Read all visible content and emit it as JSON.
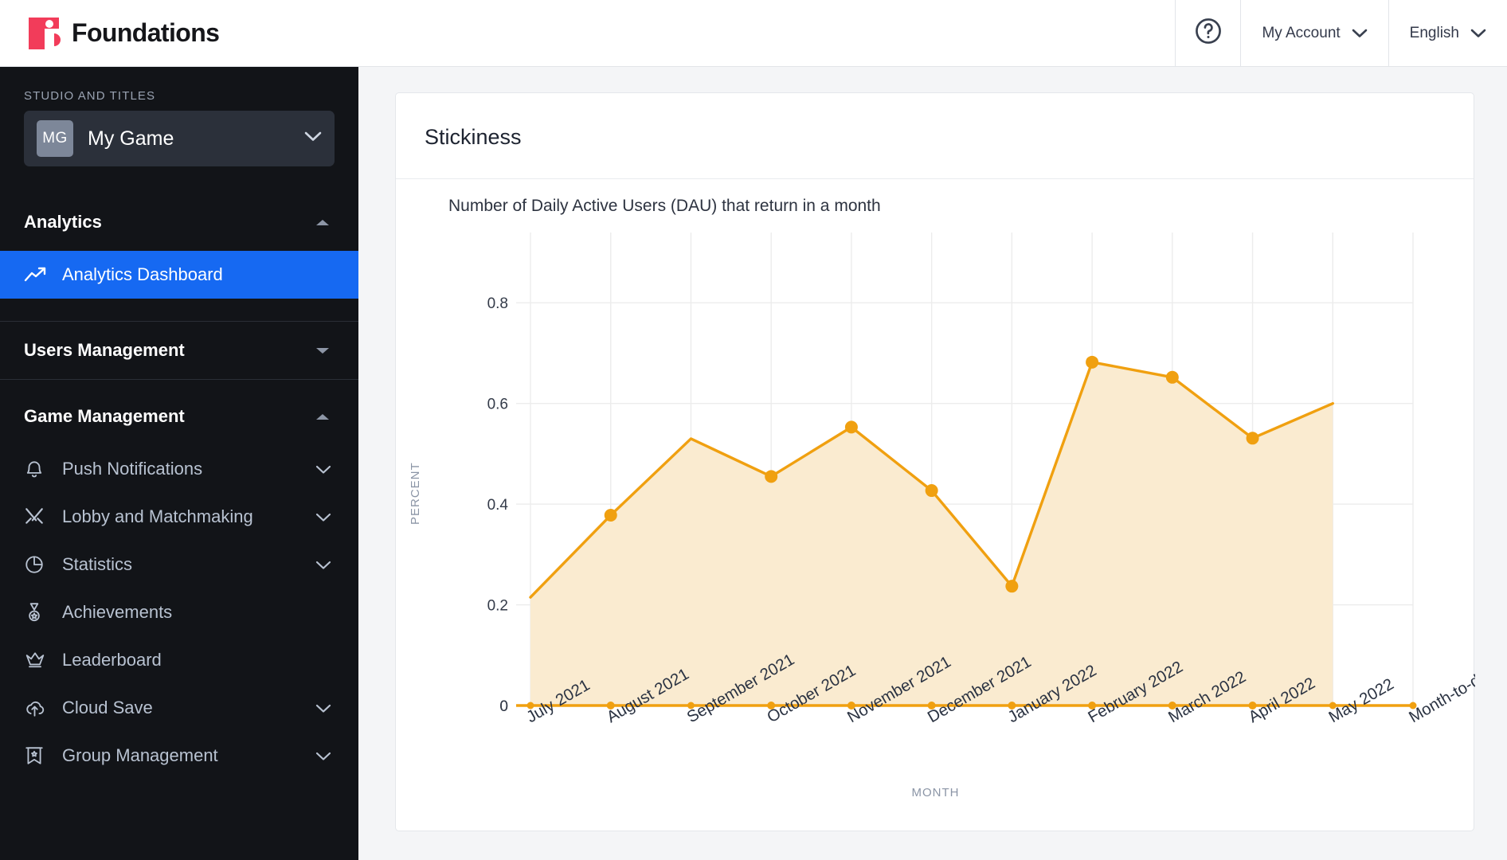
{
  "header": {
    "brand": "Foundations",
    "brand_color": "#F23C5A",
    "help_icon": "help-circle-icon",
    "account_label": "My Account",
    "language_label": "English"
  },
  "sidebar": {
    "studio_label": "STUDIO AND TITLES",
    "game": {
      "initials": "MG",
      "name": "My Game"
    },
    "sections": [
      {
        "id": "analytics",
        "label": "Analytics",
        "expanded": true,
        "items": [
          {
            "label": "Analytics Dashboard",
            "icon": "trending-up-icon",
            "active": true,
            "has_chevron": false
          }
        ]
      },
      {
        "id": "users-management",
        "label": "Users Management",
        "expanded": false,
        "items": []
      },
      {
        "id": "game-management",
        "label": "Game Management",
        "expanded": true,
        "items": [
          {
            "label": "Push Notifications",
            "icon": "bell-icon",
            "active": false,
            "has_chevron": true
          },
          {
            "label": "Lobby and Matchmaking",
            "icon": "crossed-swords-icon",
            "active": false,
            "has_chevron": true
          },
          {
            "label": "Statistics",
            "icon": "pie-chart-icon",
            "active": false,
            "has_chevron": true
          },
          {
            "label": "Achievements",
            "icon": "medal-icon",
            "active": false,
            "has_chevron": false
          },
          {
            "label": "Leaderboard",
            "icon": "crown-icon",
            "active": false,
            "has_chevron": false
          },
          {
            "label": "Cloud Save",
            "icon": "cloud-upload-icon",
            "active": false,
            "has_chevron": true
          },
          {
            "label": "Group Management",
            "icon": "banner-star-icon",
            "active": false,
            "has_chevron": true
          }
        ]
      }
    ],
    "active_accent": "#1669F2"
  },
  "card": {
    "title": "Stickiness",
    "subtitle": "Number of Daily Active Users (DAU) that return in a month"
  },
  "chart_data": {
    "type": "area",
    "title": "Stickiness",
    "subtitle": "Number of Daily Active Users (DAU) that return in a month",
    "xlabel": "MONTH",
    "ylabel": "PERCENT",
    "categories": [
      "July 2021",
      "August 2021",
      "September 2021",
      "October 2021",
      "November 2021",
      "December 2021",
      "January 2022",
      "February 2022",
      "March 2022",
      "April 2022",
      "May 2022",
      "Month-to-date"
    ],
    "values": [
      0.215,
      0.378,
      0.53,
      0.455,
      0.553,
      0.427,
      0.237,
      0.682,
      0.652,
      0.531,
      0.6,
      0
    ],
    "ylim": [
      0,
      0.9
    ],
    "yticks": [
      0,
      0.2,
      0.4,
      0.6,
      0.8
    ],
    "ytick_labels": [
      "0",
      "0.2",
      "0.4",
      "0.6",
      "0.8"
    ],
    "line_color": "#F0A010",
    "fill_color": "#FAEBD0",
    "marker_color": "#F0A010",
    "markers_shown": [
      "August 2021",
      "October 2021",
      "November 2021",
      "December 2021",
      "January 2022",
      "February 2022",
      "March 2022",
      "April 2022"
    ],
    "grid": true,
    "legend": null,
    "xtick_rotation": -30
  }
}
